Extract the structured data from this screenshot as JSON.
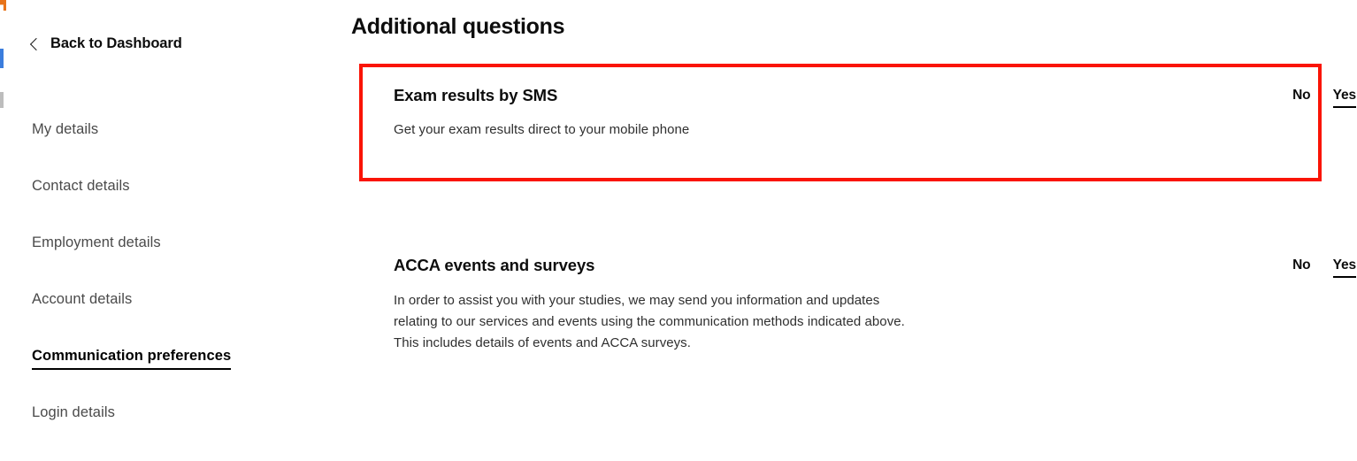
{
  "colors": {
    "annotation_red": "#fa1405",
    "text_primary": "#0d0d0d",
    "text_muted": "#4a4a4a",
    "background": "#ffffff"
  },
  "sidebar": {
    "back_link": {
      "label": "Back to Dashboard",
      "icon": "chevron-left-icon"
    },
    "items": [
      {
        "label": "My details",
        "active": false
      },
      {
        "label": "Contact details",
        "active": false
      },
      {
        "label": "Employment details",
        "active": false
      },
      {
        "label": "Account details",
        "active": false
      },
      {
        "label": "Communication preferences",
        "active": true
      },
      {
        "label": "Login details",
        "active": false
      }
    ]
  },
  "main": {
    "title": "Additional questions",
    "questions": [
      {
        "title": "Exam results by SMS",
        "description_lines": [
          "Get your exam results direct to your mobile phone"
        ],
        "options": [
          {
            "label": "No",
            "selected": false
          },
          {
            "label": "Yes",
            "selected": true
          }
        ]
      },
      {
        "title": "ACCA events and surveys",
        "description_lines": [
          "In order to assist you with your studies, we may send you information and updates",
          "relating to our services and events using the communication methods indicated above.",
          "This includes details of events and ACCA surveys."
        ],
        "options": [
          {
            "label": "No",
            "selected": false
          },
          {
            "label": "Yes",
            "selected": true
          }
        ]
      }
    ]
  }
}
